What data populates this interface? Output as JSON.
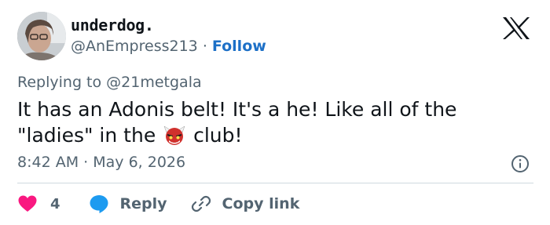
{
  "author": {
    "display_name": "underdog.",
    "handle": "@AnEmpress213",
    "separator": "·",
    "follow_label": "Follow"
  },
  "reply_context": {
    "prefix": "Replying to",
    "to": "@21metgala"
  },
  "tweet": {
    "line1": "It has an Adonis belt! It's a he! Like all of the",
    "line2_before": "\"ladies\" in the",
    "emoji_icon": "ogre-face-icon",
    "line2_after": "club!"
  },
  "meta": {
    "time": "8:42 AM",
    "separator": "·",
    "date": "May 6, 2026"
  },
  "actions": {
    "like_count": "4",
    "reply_label": "Reply",
    "copy_label": "Copy link"
  },
  "colors": {
    "like_red": "#f91880",
    "reply_blue": "#1d9bf0",
    "follow_blue": "#1d70c7",
    "muted_gray": "#536471"
  }
}
